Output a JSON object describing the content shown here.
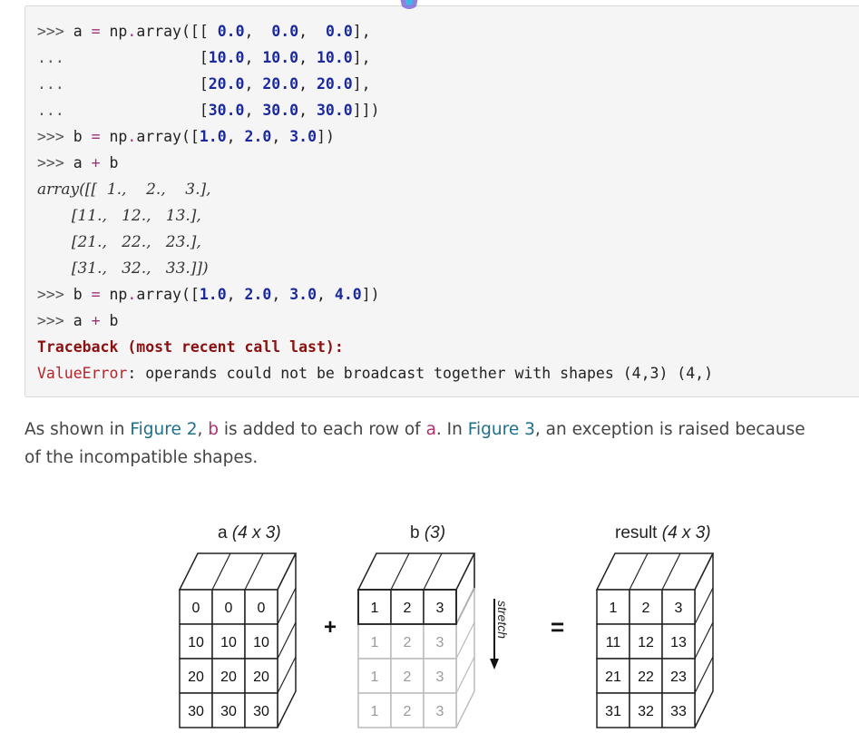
{
  "code": {
    "lines": [
      [
        [
          "prompt",
          ">>> "
        ],
        [
          "name",
          "a "
        ],
        [
          "op",
          "="
        ],
        [
          "name",
          " np"
        ],
        [
          "op",
          "."
        ],
        [
          "name",
          "array"
        ],
        [
          "punc",
          "([[ "
        ],
        [
          "num",
          "0.0"
        ],
        [
          "punc",
          ",  "
        ],
        [
          "num",
          "0.0"
        ],
        [
          "punc",
          ",  "
        ],
        [
          "num",
          "0.0"
        ],
        [
          "punc",
          "],"
        ]
      ],
      [
        [
          "prompt",
          "...               "
        ],
        [
          "punc",
          "["
        ],
        [
          "num",
          "10.0"
        ],
        [
          "punc",
          ", "
        ],
        [
          "num",
          "10.0"
        ],
        [
          "punc",
          ", "
        ],
        [
          "num",
          "10.0"
        ],
        [
          "punc",
          "],"
        ]
      ],
      [
        [
          "prompt",
          "...               "
        ],
        [
          "punc",
          "["
        ],
        [
          "num",
          "20.0"
        ],
        [
          "punc",
          ", "
        ],
        [
          "num",
          "20.0"
        ],
        [
          "punc",
          ", "
        ],
        [
          "num",
          "20.0"
        ],
        [
          "punc",
          "],"
        ]
      ],
      [
        [
          "prompt",
          "...               "
        ],
        [
          "punc",
          "["
        ],
        [
          "num",
          "30.0"
        ],
        [
          "punc",
          ", "
        ],
        [
          "num",
          "30.0"
        ],
        [
          "punc",
          ", "
        ],
        [
          "num",
          "30.0"
        ],
        [
          "punc",
          "]])"
        ]
      ],
      [
        [
          "prompt",
          ">>> "
        ],
        [
          "name",
          "b "
        ],
        [
          "op",
          "="
        ],
        [
          "name",
          " np"
        ],
        [
          "op",
          "."
        ],
        [
          "name",
          "array"
        ],
        [
          "punc",
          "(["
        ],
        [
          "num",
          "1.0"
        ],
        [
          "punc",
          ", "
        ],
        [
          "num",
          "2.0"
        ],
        [
          "punc",
          ", "
        ],
        [
          "num",
          "3.0"
        ],
        [
          "punc",
          "])"
        ]
      ],
      [
        [
          "prompt",
          ">>> "
        ],
        [
          "name",
          "a "
        ],
        [
          "op",
          "+"
        ],
        [
          "name",
          " b"
        ]
      ],
      [
        [
          "out",
          "array([[  1.,    2.,    3.],"
        ]
      ],
      [
        [
          "out",
          "       [11.,   12.,   13.],"
        ]
      ],
      [
        [
          "out",
          "       [21.,   22.,   23.],"
        ]
      ],
      [
        [
          "out",
          "       [31.,   32.,   33.]])"
        ]
      ],
      [
        [
          "prompt",
          ">>> "
        ],
        [
          "name",
          "b "
        ],
        [
          "op",
          "="
        ],
        [
          "name",
          " np"
        ],
        [
          "op",
          "."
        ],
        [
          "name",
          "array"
        ],
        [
          "punc",
          "(["
        ],
        [
          "num",
          "1.0"
        ],
        [
          "punc",
          ", "
        ],
        [
          "num",
          "2.0"
        ],
        [
          "punc",
          ", "
        ],
        [
          "num",
          "3.0"
        ],
        [
          "punc",
          ", "
        ],
        [
          "num",
          "4.0"
        ],
        [
          "punc",
          "])"
        ]
      ],
      [
        [
          "prompt",
          ">>> "
        ],
        [
          "name",
          "a "
        ],
        [
          "op",
          "+"
        ],
        [
          "name",
          " b"
        ]
      ],
      [
        [
          "tb",
          "Traceback (most recent call last):"
        ]
      ],
      [
        [
          "err",
          "ValueError"
        ],
        [
          "punc",
          ": operands could not be broadcast together with shapes (4,3) (4,)"
        ]
      ]
    ]
  },
  "paragraph": {
    "t1": "As shown in ",
    "link1": "Figure 2",
    "t2": ", ",
    "code_b": "b",
    "t3": " is added to each row of ",
    "code_a": "a",
    "t4": ". In ",
    "link2": "Figure 3",
    "t5": ", an exception is raised because of the incompatible shapes."
  },
  "figure": {
    "a_label": "a",
    "a_shape": "(4 x 3)",
    "b_label": "b",
    "b_shape": "(3)",
    "result_label": "result",
    "result_shape": "(4 x 3)",
    "plus": "+",
    "equals": "=",
    "stretch": "stretch",
    "a_rows": [
      [
        "0",
        "0",
        "0"
      ],
      [
        "10",
        "10",
        "10"
      ],
      [
        "20",
        "20",
        "20"
      ],
      [
        "30",
        "30",
        "30"
      ]
    ],
    "b_rows": [
      [
        "1",
        "2",
        "3"
      ],
      [
        "1",
        "2",
        "3"
      ],
      [
        "1",
        "2",
        "3"
      ],
      [
        "1",
        "2",
        "3"
      ]
    ],
    "result_rows": [
      [
        "1",
        "2",
        "3"
      ],
      [
        "11",
        "12",
        "13"
      ],
      [
        "21",
        "22",
        "23"
      ],
      [
        "31",
        "32",
        "33"
      ]
    ]
  },
  "colors": {
    "link": "#1f6f8b",
    "inline_code": "#b0306e",
    "number": "#1a2a9e",
    "operator": "#a0307a",
    "traceback": "#8b1010",
    "error_name": "#b3262d",
    "ghost_grid": "#bbbbbb"
  }
}
